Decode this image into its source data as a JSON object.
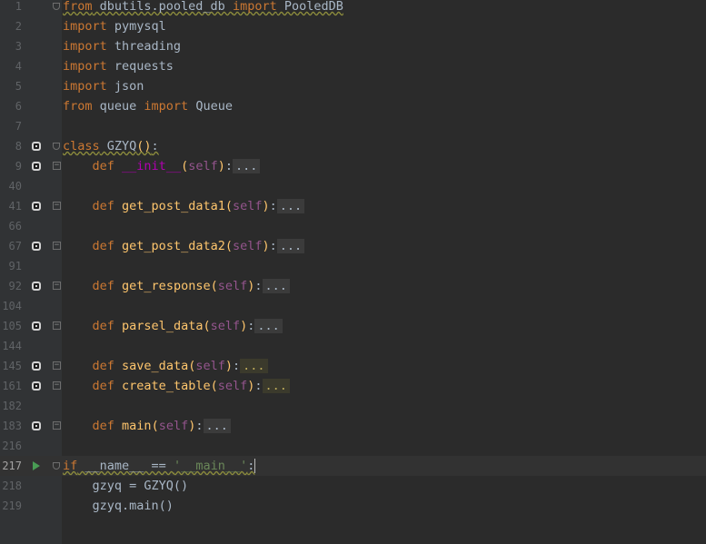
{
  "editor": {
    "lines": [
      {
        "n": "1",
        "parts": [
          [
            "kw",
            "from"
          ],
          [
            "plain",
            " dbutils.pooled_db "
          ],
          [
            "kw",
            "import"
          ],
          [
            "plain",
            " PooledDB"
          ]
        ]
      },
      {
        "n": "2",
        "parts": [
          [
            "kw",
            "import"
          ],
          [
            "plain",
            " pymysql"
          ]
        ]
      },
      {
        "n": "3",
        "parts": [
          [
            "kw",
            "import"
          ],
          [
            "plain",
            " threading"
          ]
        ]
      },
      {
        "n": "4",
        "parts": [
          [
            "kw",
            "import"
          ],
          [
            "plain",
            " requests"
          ]
        ]
      },
      {
        "n": "5",
        "parts": [
          [
            "kw",
            "import"
          ],
          [
            "plain",
            " json"
          ]
        ]
      },
      {
        "n": "6",
        "parts": [
          [
            "kw",
            "from"
          ],
          [
            "plain",
            " queue "
          ],
          [
            "kw",
            "import"
          ],
          [
            "plain",
            " Queue"
          ]
        ]
      },
      {
        "n": "7",
        "parts": []
      },
      {
        "n": "8",
        "parts": [
          [
            "kw",
            "class"
          ],
          [
            "plain",
            " GZYQ"
          ],
          [
            "fn",
            "()"
          ],
          [
            "plain",
            ":"
          ]
        ]
      },
      {
        "n": "9",
        "parts": [
          [
            "plain",
            "    "
          ],
          [
            "kw",
            "def"
          ],
          [
            "plain",
            " "
          ],
          [
            "magic",
            "__init__"
          ],
          [
            "fn",
            "("
          ],
          [
            "self",
            "self"
          ],
          [
            "fn",
            ")"
          ],
          [
            "plain",
            ":"
          ],
          [
            "fold",
            "..."
          ]
        ]
      },
      {
        "n": "40",
        "parts": []
      },
      {
        "n": "41",
        "parts": [
          [
            "plain",
            "    "
          ],
          [
            "kw",
            "def"
          ],
          [
            "plain",
            " "
          ],
          [
            "fn",
            "get_post_data1"
          ],
          [
            "fn",
            "("
          ],
          [
            "self",
            "self"
          ],
          [
            "fn",
            ")"
          ],
          [
            "plain",
            ":"
          ],
          [
            "fold",
            "..."
          ]
        ]
      },
      {
        "n": "66",
        "parts": []
      },
      {
        "n": "67",
        "parts": [
          [
            "plain",
            "    "
          ],
          [
            "kw",
            "def"
          ],
          [
            "plain",
            " "
          ],
          [
            "fn",
            "get_post_data2"
          ],
          [
            "fn",
            "("
          ],
          [
            "self",
            "self"
          ],
          [
            "fn",
            ")"
          ],
          [
            "plain",
            ":"
          ],
          [
            "fold",
            "..."
          ]
        ]
      },
      {
        "n": "91",
        "parts": []
      },
      {
        "n": "92",
        "parts": [
          [
            "plain",
            "    "
          ],
          [
            "kw",
            "def"
          ],
          [
            "plain",
            " "
          ],
          [
            "fn",
            "get_response"
          ],
          [
            "fn",
            "("
          ],
          [
            "self",
            "self"
          ],
          [
            "fn",
            ")"
          ],
          [
            "plain",
            ":"
          ],
          [
            "fold",
            "..."
          ]
        ]
      },
      {
        "n": "104",
        "parts": []
      },
      {
        "n": "105",
        "parts": [
          [
            "plain",
            "    "
          ],
          [
            "kw",
            "def"
          ],
          [
            "plain",
            " "
          ],
          [
            "fn",
            "parsel_data"
          ],
          [
            "fn",
            "("
          ],
          [
            "self",
            "self"
          ],
          [
            "fn",
            ")"
          ],
          [
            "plain",
            ":"
          ],
          [
            "fold",
            "..."
          ]
        ]
      },
      {
        "n": "144",
        "parts": []
      },
      {
        "n": "145",
        "parts": [
          [
            "plain",
            "    "
          ],
          [
            "kw",
            "def"
          ],
          [
            "plain",
            " "
          ],
          [
            "fn",
            "save_data"
          ],
          [
            "fn",
            "("
          ],
          [
            "self",
            "self"
          ],
          [
            "fn",
            ")"
          ],
          [
            "plain",
            ":"
          ],
          [
            "foldhl",
            "..."
          ]
        ]
      },
      {
        "n": "161",
        "parts": [
          [
            "plain",
            "    "
          ],
          [
            "kw",
            "def"
          ],
          [
            "plain",
            " "
          ],
          [
            "fn",
            "create_table"
          ],
          [
            "fn",
            "("
          ],
          [
            "self",
            "self"
          ],
          [
            "fn",
            ")"
          ],
          [
            "plain",
            ":"
          ],
          [
            "foldhl",
            "..."
          ]
        ]
      },
      {
        "n": "182",
        "parts": []
      },
      {
        "n": "183",
        "parts": [
          [
            "plain",
            "    "
          ],
          [
            "kw",
            "def"
          ],
          [
            "plain",
            " "
          ],
          [
            "fn",
            "main"
          ],
          [
            "fn",
            "("
          ],
          [
            "self",
            "self"
          ],
          [
            "fn",
            ")"
          ],
          [
            "plain",
            ":"
          ],
          [
            "fold",
            "..."
          ]
        ]
      },
      {
        "n": "216",
        "parts": []
      },
      {
        "n": "217",
        "parts": [
          [
            "kw",
            "if"
          ],
          [
            "plain",
            " __name__ == "
          ],
          [
            "str",
            "'__main__'"
          ],
          [
            "plain",
            ":"
          ]
        ]
      },
      {
        "n": "218",
        "parts": [
          [
            "plain",
            "    gzyq = GZYQ()"
          ]
        ]
      },
      {
        "n": "219",
        "parts": [
          [
            "plain",
            "    gzyq.main()"
          ]
        ]
      }
    ],
    "markers": {
      "8": "breakpoint-icon",
      "9": "breakpoint-icon",
      "41": "breakpoint-icon",
      "67": "breakpoint-icon",
      "92": "breakpoint-icon",
      "105": "breakpoint-icon",
      "145": "breakpoint-icon",
      "161": "breakpoint-icon",
      "183": "breakpoint-icon",
      "217": "run-icon"
    },
    "colors": {
      "background": "#2b2b2b",
      "keyword": "#cc7832",
      "function": "#ffc66d",
      "self": "#94558d",
      "magic": "#b200b2",
      "string": "#6a8759",
      "text": "#a9b7c6",
      "gutter": "#313335"
    }
  }
}
